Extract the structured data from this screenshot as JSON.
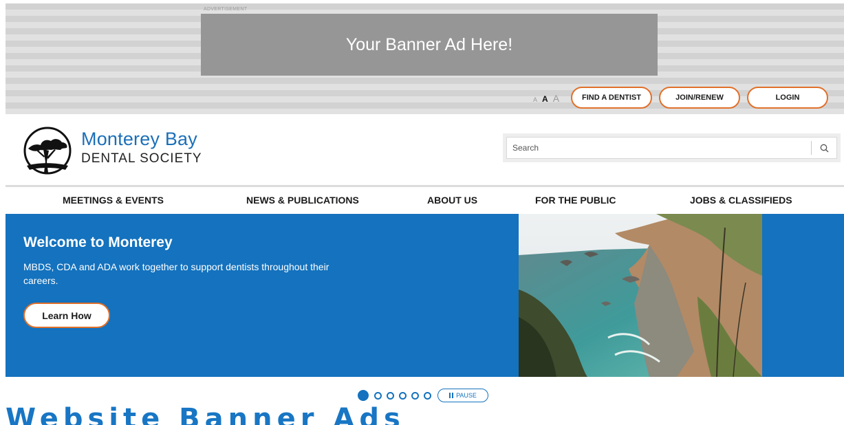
{
  "advertisement": {
    "label": "ADVERTISEMENT",
    "banner_text": "Your Banner Ad Here!"
  },
  "utility": {
    "font_small": "A",
    "font_medium": "A",
    "font_large": "A",
    "find_dentist": "FIND A DENTIST",
    "join_renew": "JOIN/RENEW",
    "login": "LOGIN"
  },
  "logo": {
    "title": "Monterey Bay",
    "subtitle": "DENTAL SOCIETY",
    "icon": "cypress-tree-logo-icon"
  },
  "search": {
    "placeholder": "Search",
    "icon": "search-icon"
  },
  "nav": {
    "items": [
      {
        "label": "MEETINGS & EVENTS"
      },
      {
        "label": "NEWS & PUBLICATIONS"
      },
      {
        "label": "ABOUT US"
      },
      {
        "label": "FOR THE PUBLIC"
      },
      {
        "label": "JOBS & CLASSIFIEDS"
      }
    ]
  },
  "hero": {
    "title": "Welcome to Monterey",
    "text": "MBDS, CDA and ADA work together to support dentists throughout their careers.",
    "button": "Learn How"
  },
  "slider": {
    "active_index": 0,
    "slide_count": 6,
    "pause_label": "PAUSE"
  },
  "page_heading": "Website Banner Ads",
  "colors": {
    "brand_blue": "#1472be",
    "accent_orange": "#e0702a"
  }
}
